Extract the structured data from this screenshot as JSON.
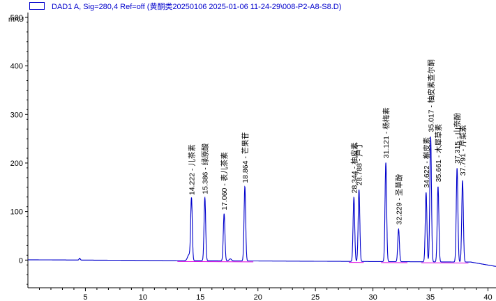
{
  "legend": {
    "label": "DAD1 A, Sig=280,4 Ref=off (黄酮类20250106 2025-01-06 11-24-29\\008-P2-A8-S8.D)",
    "color": "#0000cc"
  },
  "chart_data": {
    "type": "line",
    "title": "",
    "xlabel": "",
    "ylabel": "mAU",
    "xlim": [
      0,
      40.7
    ],
    "ylim": [
      -57,
      510
    ],
    "x_ticks": [
      5,
      10,
      15,
      20,
      25,
      30,
      35,
      40
    ],
    "y_ticks": [
      0,
      100,
      200,
      300,
      400,
      500
    ],
    "grid": false,
    "trace_color": "#0000cc",
    "baseline_color": "#e000e0",
    "series": [
      {
        "name": "DAD1 A, Sig=280,4 Ref=off",
        "peaks": [
          {
            "rt": 14.222,
            "name": "儿茶素",
            "height": 128
          },
          {
            "rt": 15.386,
            "name": "绿原酸",
            "height": 130
          },
          {
            "rt": 17.06,
            "name": "表儿茶素",
            "height": 97
          },
          {
            "rt": 18.864,
            "name": "芒果苷",
            "height": 153
          },
          {
            "rt": 28.344,
            "name": "柚皮素",
            "height": 132
          },
          {
            "rt": 28.788,
            "name": "芦丁",
            "height": 148
          },
          {
            "rt": 31.121,
            "name": "杨梅素",
            "height": 204
          },
          {
            "rt": 32.229,
            "name": "圣草酚",
            "height": 67
          },
          {
            "rt": 34.622,
            "name": "槲皮素",
            "height": 143
          },
          {
            "rt": 35.017,
            "name": "柚皮素查尔酮",
            "height": 258
          },
          {
            "rt": 35.661,
            "name": "木犀草素",
            "height": 155
          },
          {
            "rt": 37.315,
            "name": "山奈酚",
            "height": 193
          },
          {
            "rt": 37.791,
            "name": "芹菜素",
            "height": 168
          }
        ]
      }
    ]
  }
}
